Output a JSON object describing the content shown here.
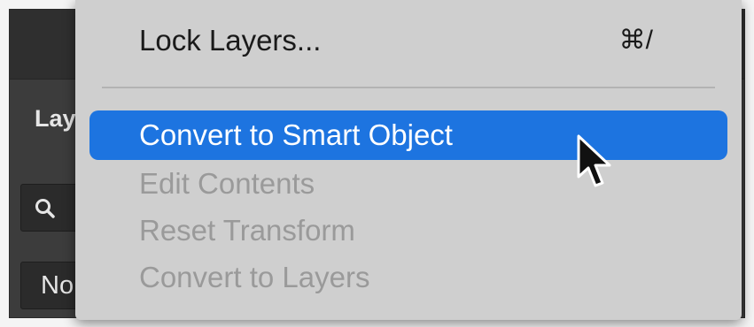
{
  "panel": {
    "tab_label": "Lay",
    "blend_mode_label": "No",
    "search_icon": "search-icon"
  },
  "menu": {
    "items": [
      {
        "label": "Lock Layers...",
        "shortcut": "⌘/",
        "state": "enabled"
      },
      {
        "label": "Convert to Smart Object",
        "state": "highlighted"
      },
      {
        "label": "Edit Contents",
        "state": "disabled"
      },
      {
        "label": "Reset Transform",
        "state": "disabled"
      },
      {
        "label": "Convert to Layers",
        "state": "disabled"
      }
    ]
  },
  "colors": {
    "highlight": "#1d74e0",
    "menu_background": "#cfcfcf",
    "disabled_text": "#9a9a9a",
    "panel_background": "#3c3c3c"
  },
  "cursor_icon": "arrow-pointer-icon"
}
